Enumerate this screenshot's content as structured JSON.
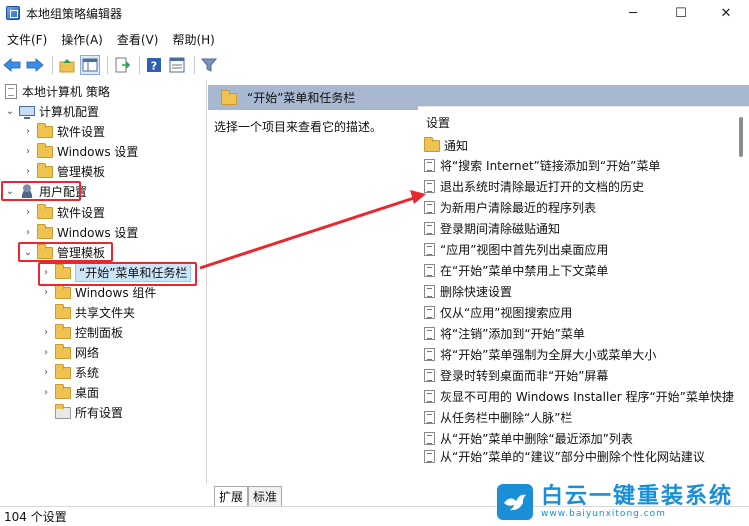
{
  "window": {
    "title": "本地组策略编辑器",
    "minimize": "─",
    "maximize": "☐",
    "close": "✕"
  },
  "menu": [
    "文件(F)",
    "操作(A)",
    "查看(V)",
    "帮助(H)"
  ],
  "tree": {
    "root": "本地计算机 策略",
    "computer_config": "计算机配置",
    "cc_software": "软件设置",
    "cc_windows": "Windows 设置",
    "cc_admin": "管理模板",
    "user_config": "用户配置",
    "uc_software": "软件设置",
    "uc_windows": "Windows 设置",
    "uc_admin": "管理模板",
    "start_menu": "“开始”菜单和任务栏",
    "win_components": "Windows 组件",
    "shared_folder": "共享文件夹",
    "control_panel": "控制面板",
    "network": "网络",
    "system": "系统",
    "desktop": "桌面",
    "all_settings": "所有设置"
  },
  "right": {
    "header": "“开始”菜单和任务栏",
    "description": "选择一个项目来查看它的描述。",
    "column": "设置",
    "folder_item": "通知",
    "settings": [
      "将“搜索 Internet”链接添加到“开始”菜单",
      "退出系统时清除最近打开的文档的历史",
      "为新用户清除最近的程序列表",
      "登录期间清除磁贴通知",
      "“应用”视图中首先列出桌面应用",
      "在“开始”菜单中禁用上下文菜单",
      "删除快速设置",
      "仅从“应用”视图搜索应用",
      "将“注销”添加到“开始”菜单",
      "将“开始”菜单强制为全屏大小或菜单大小",
      "登录时转到桌面而非“开始”屏幕",
      "灰显不可用的 Windows Installer 程序“开始”菜单快捷",
      "从任务栏中删除“人脉”栏",
      "从“开始”菜单中删除“最近添加”列表",
      "从“开始”菜单的“建议”部分中删除个性化网站建议"
    ]
  },
  "tabs": [
    "扩展",
    "标准"
  ],
  "status": "104 个设置",
  "watermark": {
    "title": "白云一键重装系统",
    "url": "www.baiyunxitong.com"
  },
  "colors": {
    "annotation": "#e8282e",
    "header_bg": "#a7b8d0",
    "brand": "#1a8fd8"
  }
}
